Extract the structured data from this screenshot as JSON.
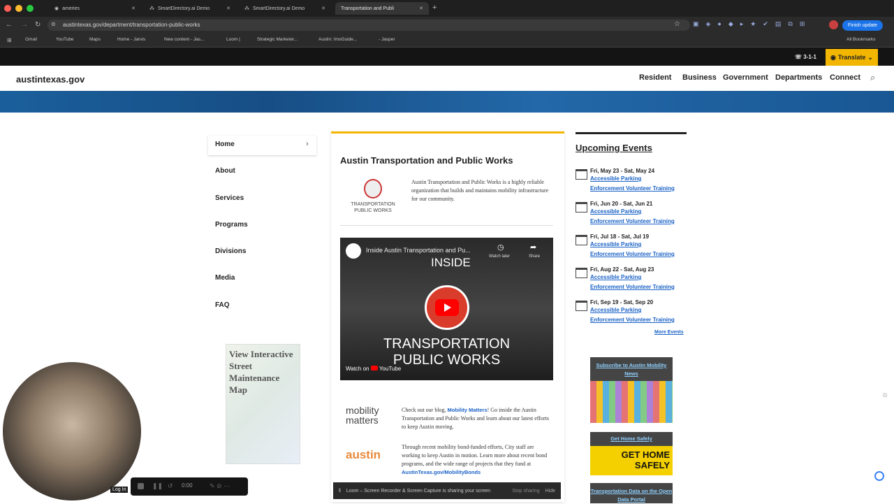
{
  "browser": {
    "tabs": [
      "ameries",
      "SmartDirectory.ai Demo",
      "SmartDirectory.ai Demo",
      "Transportation and Publi"
    ],
    "url": "austintexas.gov/department/transportation-public-works",
    "update_label": "Finish update",
    "bookmarks": [
      "Gmail",
      "YouTube",
      "Maps",
      "Home - Jarvis",
      "New content - Jas...",
      "Loom |",
      "Strategic Marketer...",
      "Austin: ImoGuide...",
      "- Jasper"
    ],
    "all_bookmarks": "All Bookmarks"
  },
  "utility": {
    "phone": "3-1-1",
    "translate": "Translate"
  },
  "site": {
    "logo": "austintexas.gov",
    "nav": [
      "Resident",
      "Business",
      "Government",
      "Departments",
      "Connect"
    ]
  },
  "sidenav": [
    "Home",
    "About",
    "Services",
    "Programs",
    "Divisions",
    "Media",
    "FAQ"
  ],
  "map_promo": "View Interactive Street Maintenance Map",
  "main": {
    "title": "Austin Transportation and Public Works",
    "logo_text": [
      "TRANSPORTATION",
      "PUBLIC WORKS"
    ],
    "intro": "Austin Transportation and Public Works is a highly reliable organization that builds and maintains mobility infrastructure for our community.",
    "video": {
      "title": "Inside Austin Transportation and Pu...",
      "watch_later": "Watch later",
      "share": "Share",
      "inside": "INSIDE",
      "caption_line1": "TRANSPORTATION",
      "caption_line2": "PUBLIC WORKS",
      "watch_on": "Watch on",
      "youtube": "YouTube"
    },
    "blog_logo": [
      "mobility",
      "matters"
    ],
    "blog_text_pre": "Check out our blog,",
    "blog_link": "Mobility Matters",
    "blog_text_post": "! Go inside the Austin Transportation and Public Works and learn about our latest efforts to keep Austin moving.",
    "bond_logo": "austin",
    "bond_text": "Through recent mobility bond-funded efforts, City staff are working to keep Austin in motion. Learn more about recent bond programs, and the wide range of projects that they fund at",
    "bond_link": "AustinTexas.gov/MobilityBonds"
  },
  "events": {
    "heading": "Upcoming Events",
    "items": [
      {
        "date": "Fri, May 23 - Sat, May 24",
        "line1": "Accessible Parking",
        "line2": "Enforcement Volunteer Training"
      },
      {
        "date": "Fri, Jun 20 - Sat, Jun 21",
        "line1": "Accessible Parking",
        "line2": "Enforcement Volunteer Training"
      },
      {
        "date": "Fri, Jul 18 - Sat, Jul 19",
        "line1": "Accessible Parking",
        "line2": "Enforcement Volunteer Training"
      },
      {
        "date": "Fri, Aug 22 - Sat, Aug 23",
        "line1": "Accessible Parking",
        "line2": "Enforcement Volunteer Training"
      },
      {
        "date": "Fri, Sep 19 - Sat, Sep 20",
        "line1": "Accessible Parking",
        "line2": "Enforcement Volunteer Training"
      }
    ],
    "more": "More Events"
  },
  "promos": {
    "subscribe": "Subscribe to Austin Mobility News",
    "home_safely": "Get Home Safely",
    "home_safely_art": [
      "GET HOME",
      "SAFELY"
    ],
    "open_data": "Transportation Data on the Open Data Portal"
  },
  "loom": {
    "time": "0:00",
    "login": "Log In",
    "share_notice": "Loom – Screen Recorder & Screen Capture is sharing your screen",
    "stop": "Stop sharing",
    "hide": "Hide"
  },
  "colors": {
    "accent": "#f2b600",
    "link": "#1a62c6",
    "banner": "#1a5f9c"
  }
}
